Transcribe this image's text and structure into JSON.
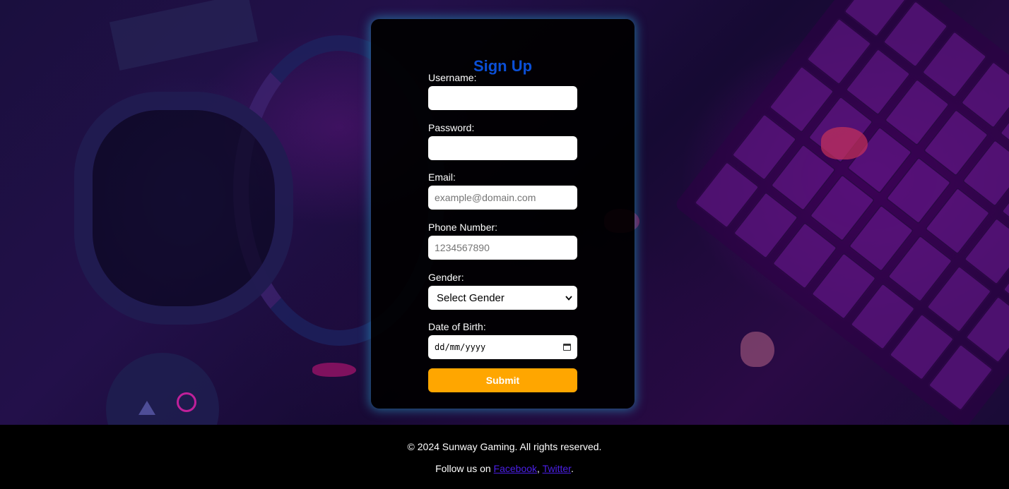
{
  "form": {
    "title": "Sign Up",
    "username": {
      "label": "Username:",
      "value": "",
      "placeholder": ""
    },
    "password": {
      "label": "Password:",
      "value": "",
      "placeholder": ""
    },
    "email": {
      "label": "Email:",
      "value": "",
      "placeholder": "example@domain.com"
    },
    "phone": {
      "label": "Phone Number:",
      "value": "",
      "placeholder": "1234567890"
    },
    "gender": {
      "label": "Gender:",
      "selected": "Select Gender"
    },
    "dob": {
      "label": "Date of Birth:",
      "placeholder": "dd/mm/yyyy"
    },
    "submit_label": "Submit"
  },
  "footer": {
    "copyright": "© 2024 Sunway Gaming. All rights reserved.",
    "follow_prefix": "Follow us on ",
    "facebook": "Facebook",
    "separator": ", ",
    "twitter": "Twitter",
    "suffix": "."
  },
  "colors": {
    "title": "#0b4fd6",
    "submit": "#ffa600",
    "card_glow": "#28a0c8",
    "link": "#4b1fe6"
  },
  "icons": [
    "calendar-icon",
    "chevron-down-icon"
  ]
}
